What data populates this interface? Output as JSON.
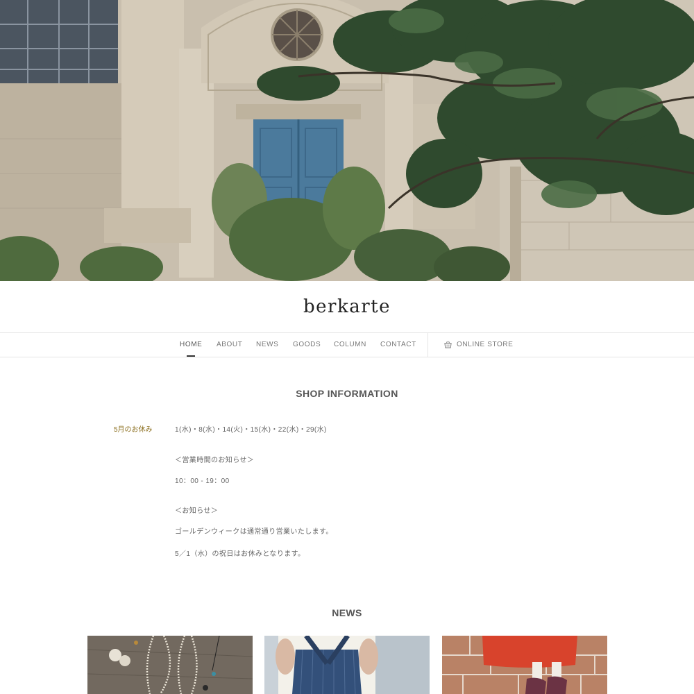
{
  "brand": {
    "name": "berkarte"
  },
  "nav": {
    "items": [
      {
        "label": "HOME"
      },
      {
        "label": "ABOUT"
      },
      {
        "label": "NEWS"
      },
      {
        "label": "GOODS"
      },
      {
        "label": "COLUMN"
      },
      {
        "label": "CONTACT"
      }
    ],
    "active_index": 0,
    "store_label": "ONLINE STORE",
    "store_icon": "basket-icon"
  },
  "shop_info": {
    "title": "SHOP INFORMATION",
    "label": "5月のお休み",
    "lines": [
      "1(水)・8(水)・14(火)・15(水)・22(水)・29(水)",
      "＜営業時間のお知らせ＞",
      "10：00 - 19：00",
      "＜お知らせ＞",
      "ゴールデンウィークは通常通り営業いたします。",
      "5／1（水）の祝日はお休みとなります。"
    ]
  },
  "news": {
    "title": "NEWS",
    "cards": [
      {
        "image": "necklaces-photo"
      },
      {
        "image": "striped-apron-photo"
      },
      {
        "image": "red-skirt-sandals-photo"
      }
    ]
  },
  "colors": {
    "accent_label": "#8a6d1c",
    "border": "#e4e4e4",
    "door_blue": "#4b7a9c"
  }
}
